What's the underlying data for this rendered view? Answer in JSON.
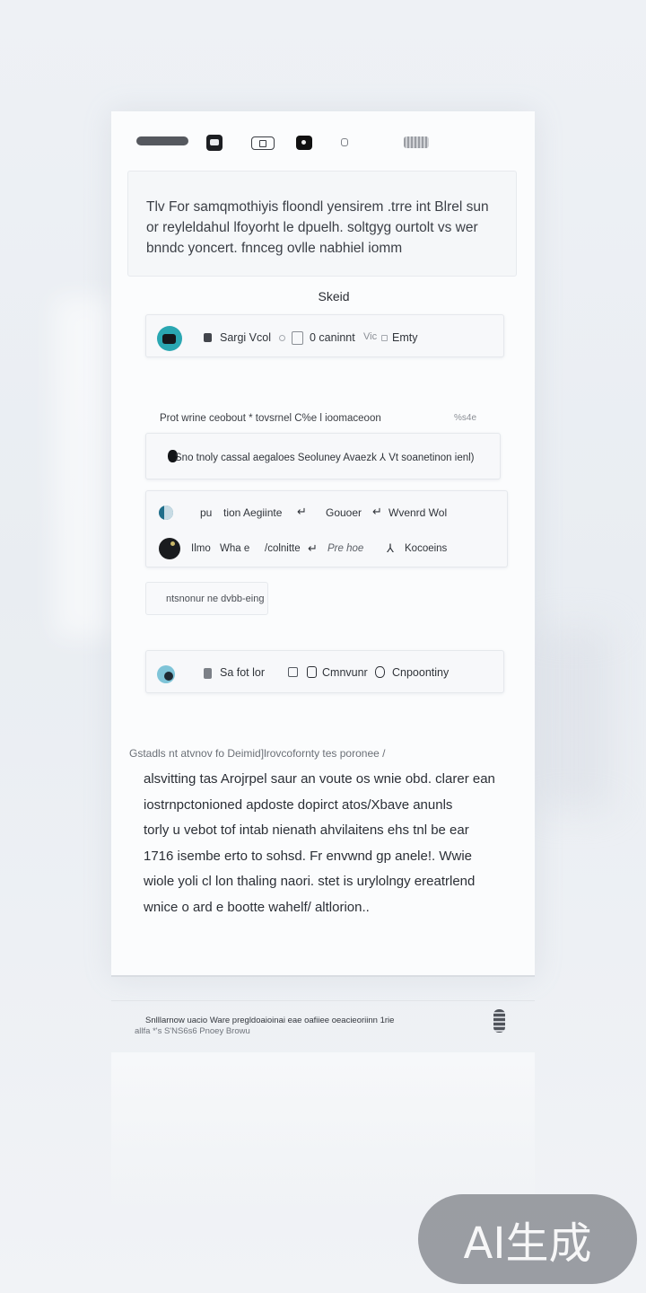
{
  "intro": {
    "line1": "Tlv For samqmothiyis floondl yensirem .trre int Blrel sun",
    "line2": "or reyleldahul lfoyorht le dpuelh. soltgyg ourtolt vs wer",
    "line3": "bnndc yoncert. fnnceg ovlle nabhiel iomm"
  },
  "section_label": "Skeid",
  "row1": {
    "label_a": "Sargi Vcol",
    "label_b": "0 caninnt",
    "label_c": "Vic",
    "label_d": "Emty"
  },
  "list_header": {
    "left": "Prot wrine ceobout * tovsrnel C%e l ioomaceoon",
    "right": "%s4e"
  },
  "row2": {
    "text": "Sno tnoly cassal aegaloes Seoluney Avaezk ⅄ Vt soanetinon ienl)"
  },
  "row3": {
    "line1": [
      "pu",
      "tion Aegiinte",
      "Gouoer",
      "Wvenrd Wol"
    ],
    "line2": [
      "Ilmo",
      "Wha e",
      "/colnitte",
      "Pre hoe",
      "Kocoeins"
    ]
  },
  "tag_chip": "ntsnonur ne dvbb-eing",
  "row4": {
    "label_a": "Sa fot lor",
    "label_b": "Cmnvunr",
    "label_c": "Cnpoontiny"
  },
  "paragraph": {
    "header": "Gstadls nt atvnov fo Deimid]lrovcofornty tes poronee /",
    "lines": [
      "alsvitting tas Arojrpel saur an voute os wnie obd. clarer ean",
      "iostrnpctonioned apdoste dopirct atos/Xbave anunls",
      "torly u vebot tof intab nienath ahvilaitens ehs tnl be ear",
      "1716 isembe erto to sohsd. Fr envwnd gp anele!. Wwie",
      "wiole yoli cl lon thaling naori. stet is urylolngy ereatrlend",
      "wnice o ard e bootte wahelf/ altlorion.."
    ]
  },
  "footer": {
    "line1": "Snlllarnow uacio Ware pregldoaioinai eae oafiiee oeacieoriinn 1rie",
    "line2": "allfa *'s S'NS6s6 Pnoey Browu"
  },
  "watermark": "AI生成"
}
